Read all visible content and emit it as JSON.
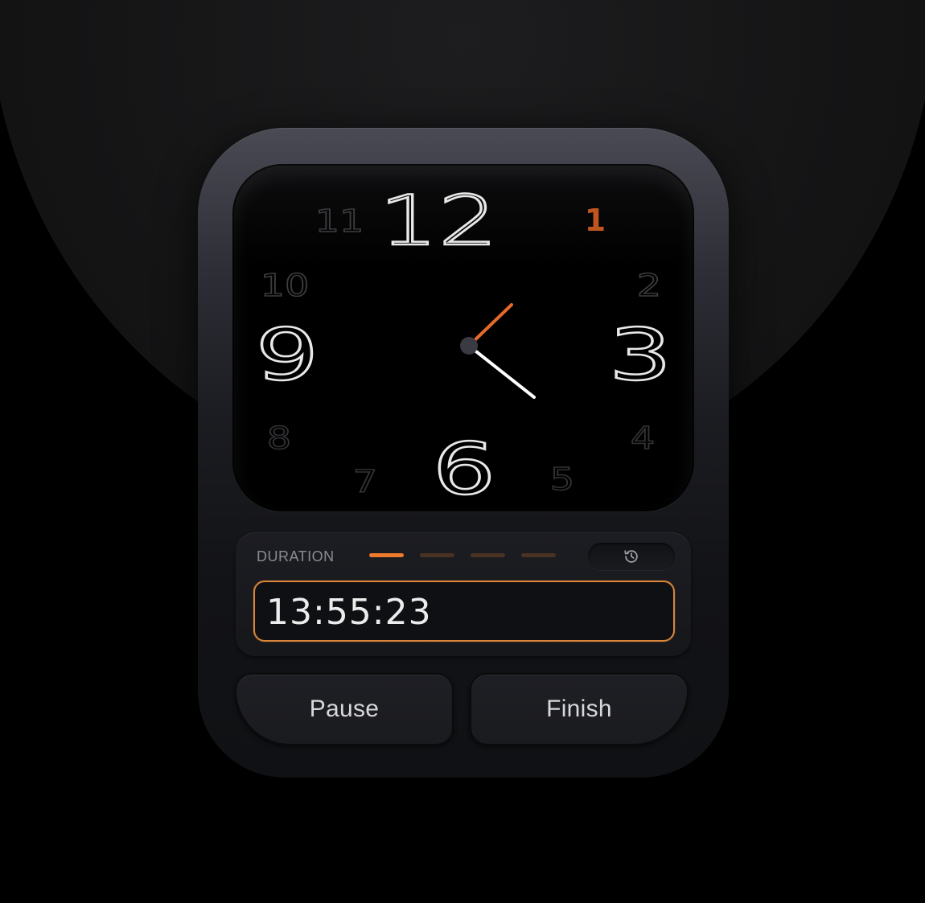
{
  "clock": {
    "numerals": {
      "n12": "12",
      "n1": "1",
      "n2": "2",
      "n3": "3",
      "n4": "4",
      "n5": "5",
      "n6": "6",
      "n7": "7",
      "n8": "8",
      "n9": "9",
      "n10": "10",
      "n11": "11"
    },
    "accent_color": "#e56a2a",
    "hand_color": "#ffffff"
  },
  "duration": {
    "label": "DURATION",
    "value": "13:55:23",
    "steps_total": 4,
    "steps_active": 1,
    "history_icon": "history-icon"
  },
  "actions": {
    "pause_label": "Pause",
    "finish_label": "Finish"
  },
  "colors": {
    "accent": "#f07a2c",
    "field_border": "#d9863a"
  }
}
